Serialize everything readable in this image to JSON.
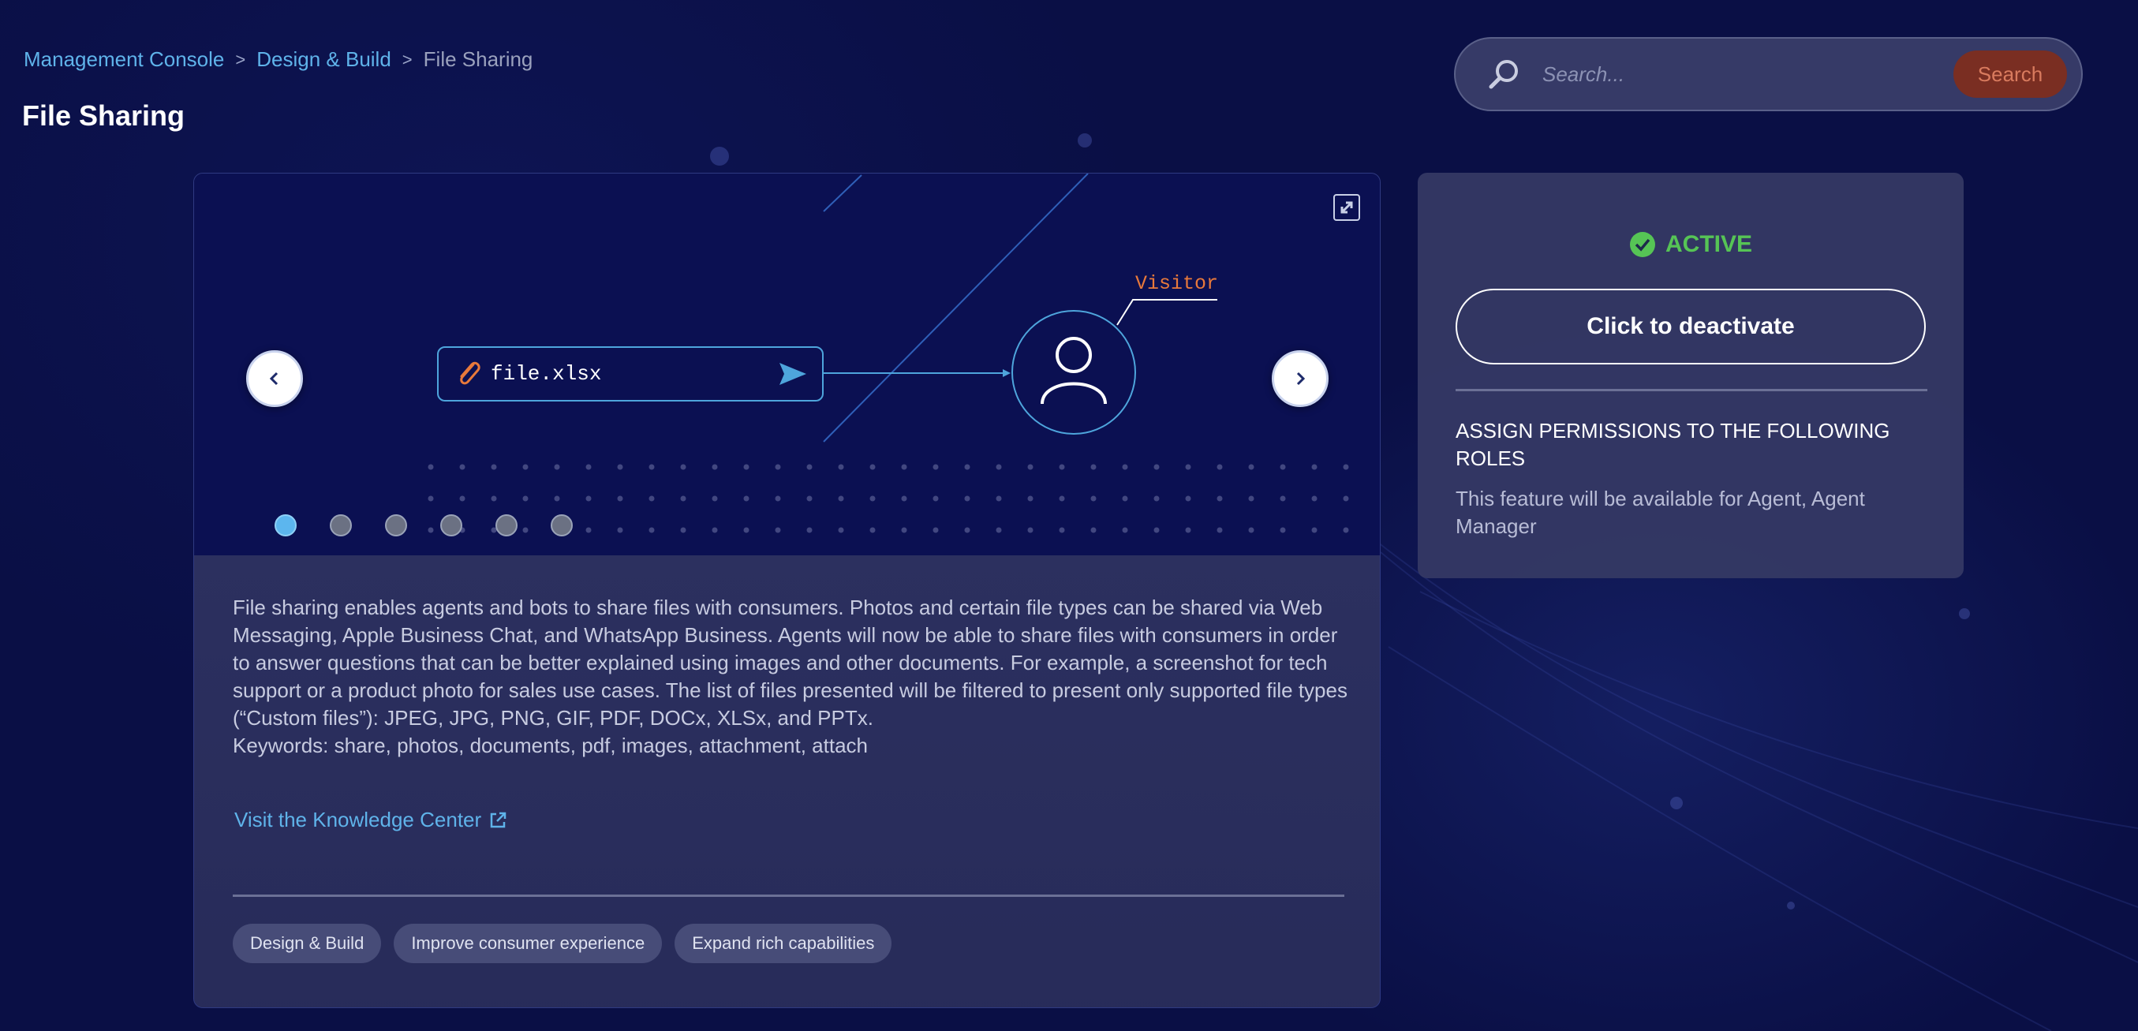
{
  "breadcrumb": {
    "items": [
      "Management Console",
      "Design & Build"
    ],
    "separator": ">",
    "current": "File Sharing"
  },
  "page": {
    "title": "File Sharing"
  },
  "search": {
    "placeholder": "Search...",
    "button_label": "Search",
    "icon": "search-icon"
  },
  "carousel": {
    "file_name": "file.xlsx",
    "visitor_label": "Visitor",
    "slide_count": 6,
    "active_slide": 1,
    "icons": {
      "attachment": "paperclip-icon",
      "send": "send-icon",
      "user": "user-avatar-icon",
      "expand": "expand-icon",
      "prev": "chevron-left-icon",
      "next": "chevron-right-icon"
    }
  },
  "feature": {
    "description": "File sharing enables agents and bots to share files with consumers. Photos and certain file types can be shared via Web Messaging, Apple Business Chat, and WhatsApp Business. Agents will now be able to share files with consumers in order to answer questions that can be better explained using images and other documents. For example, a screenshot for tech support or a product photo for sales use cases. The list of files presented will be filtered to present only supported file types (“Custom files”): JPEG, JPG, PNG, GIF, PDF, DOCx, XLSx, and PPTx.",
    "keywords": "Keywords: share, photos, documents, pdf, images, attachment, attach",
    "knowledge_link": "Visit the Knowledge Center",
    "tags": [
      "Design & Build",
      "Improve consumer experience",
      "Expand rich capabilities"
    ]
  },
  "status": {
    "label": "ACTIVE",
    "deactivate_label": "Click to deactivate",
    "permissions_heading": "ASSIGN PERMISSIONS TO THE FOLLOWING ROLES",
    "permissions_text": "This feature will be available for Agent, Agent Manager"
  },
  "colors": {
    "background": "#0a0f45",
    "accent_link": "#5fb3ea",
    "active_green": "#56c455",
    "search_button": "#7a2e22",
    "visitor_orange": "#e8793b"
  }
}
